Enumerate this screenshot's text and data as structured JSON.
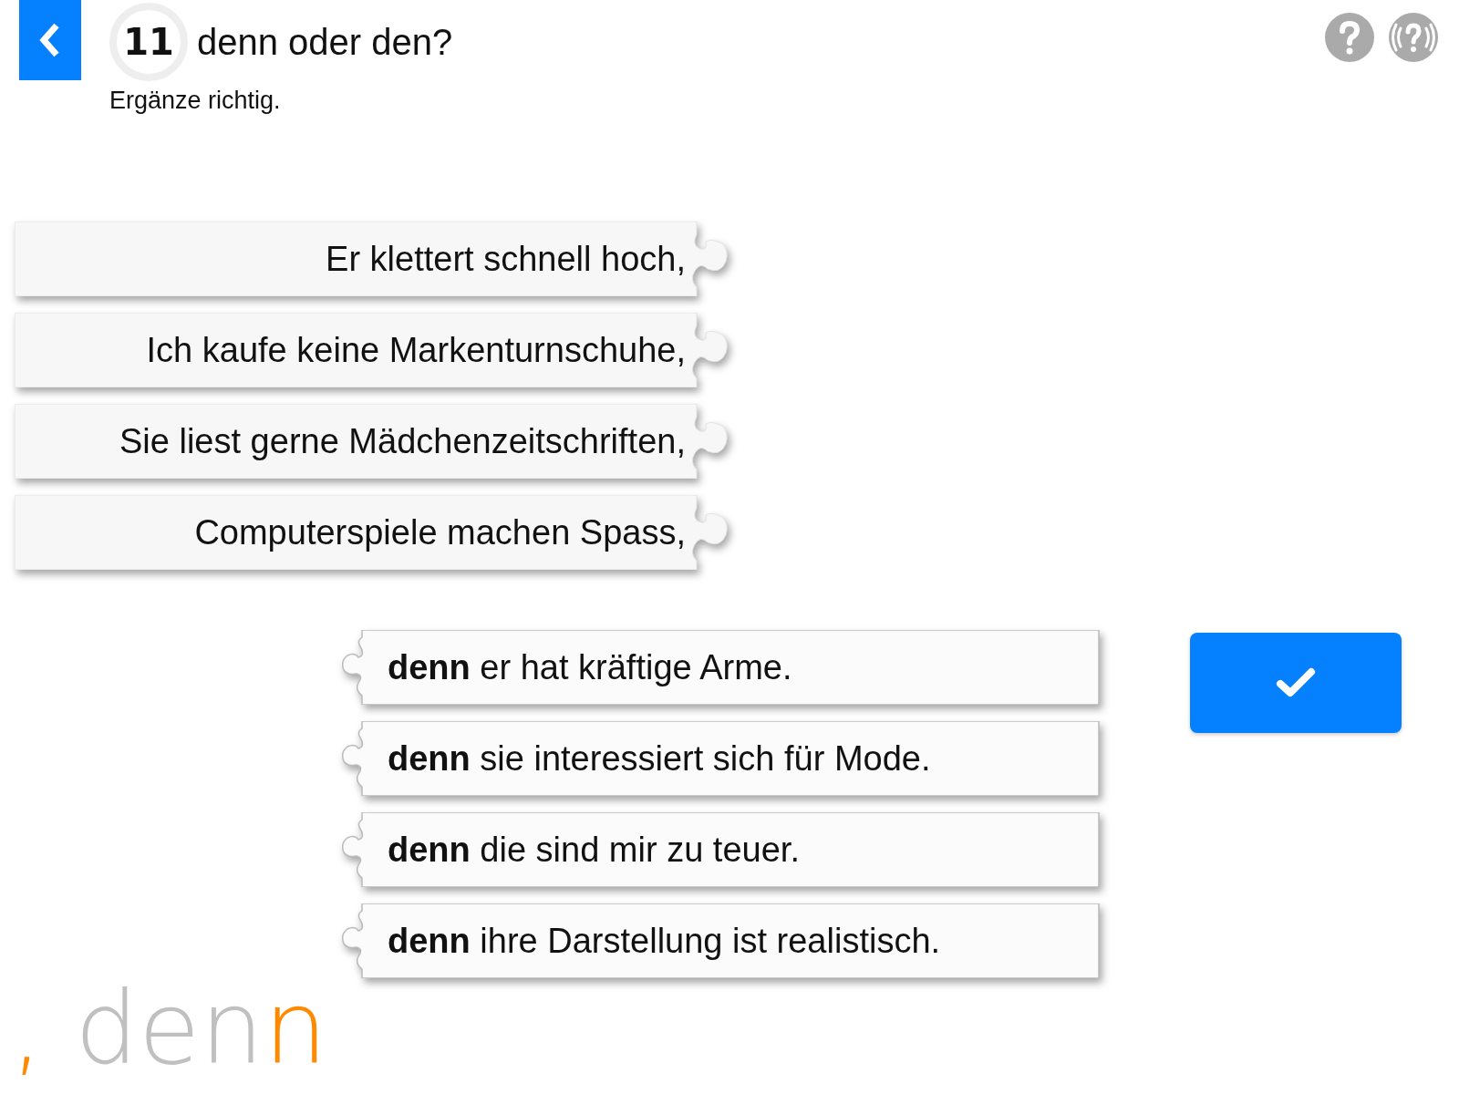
{
  "header": {
    "number": "11",
    "title": "denn oder den?",
    "instruction": "Ergänze richtig."
  },
  "left_pieces": [
    {
      "text": "Er klettert schnell hoch,"
    },
    {
      "text": "Ich kaufe keine Markenturnschuhe,"
    },
    {
      "text": "Sie liest gerne Mädchenzeitschriften,"
    },
    {
      "text": "Computerspiele machen Spass,"
    }
  ],
  "right_pieces": [
    {
      "text": "**denn** er hat kräftige Arme."
    },
    {
      "text": "**denn** sie interessiert sich für Mode."
    },
    {
      "text": "**denn** die sind mir zu teuer."
    },
    {
      "text": "**denn** ihre Darstellung ist realistisch."
    }
  ],
  "logo": [
    {
      "text": ",",
      "kind": "accent"
    },
    {
      "text": " den",
      "kind": "plain"
    },
    {
      "text": "n",
      "kind": "accent"
    }
  ]
}
